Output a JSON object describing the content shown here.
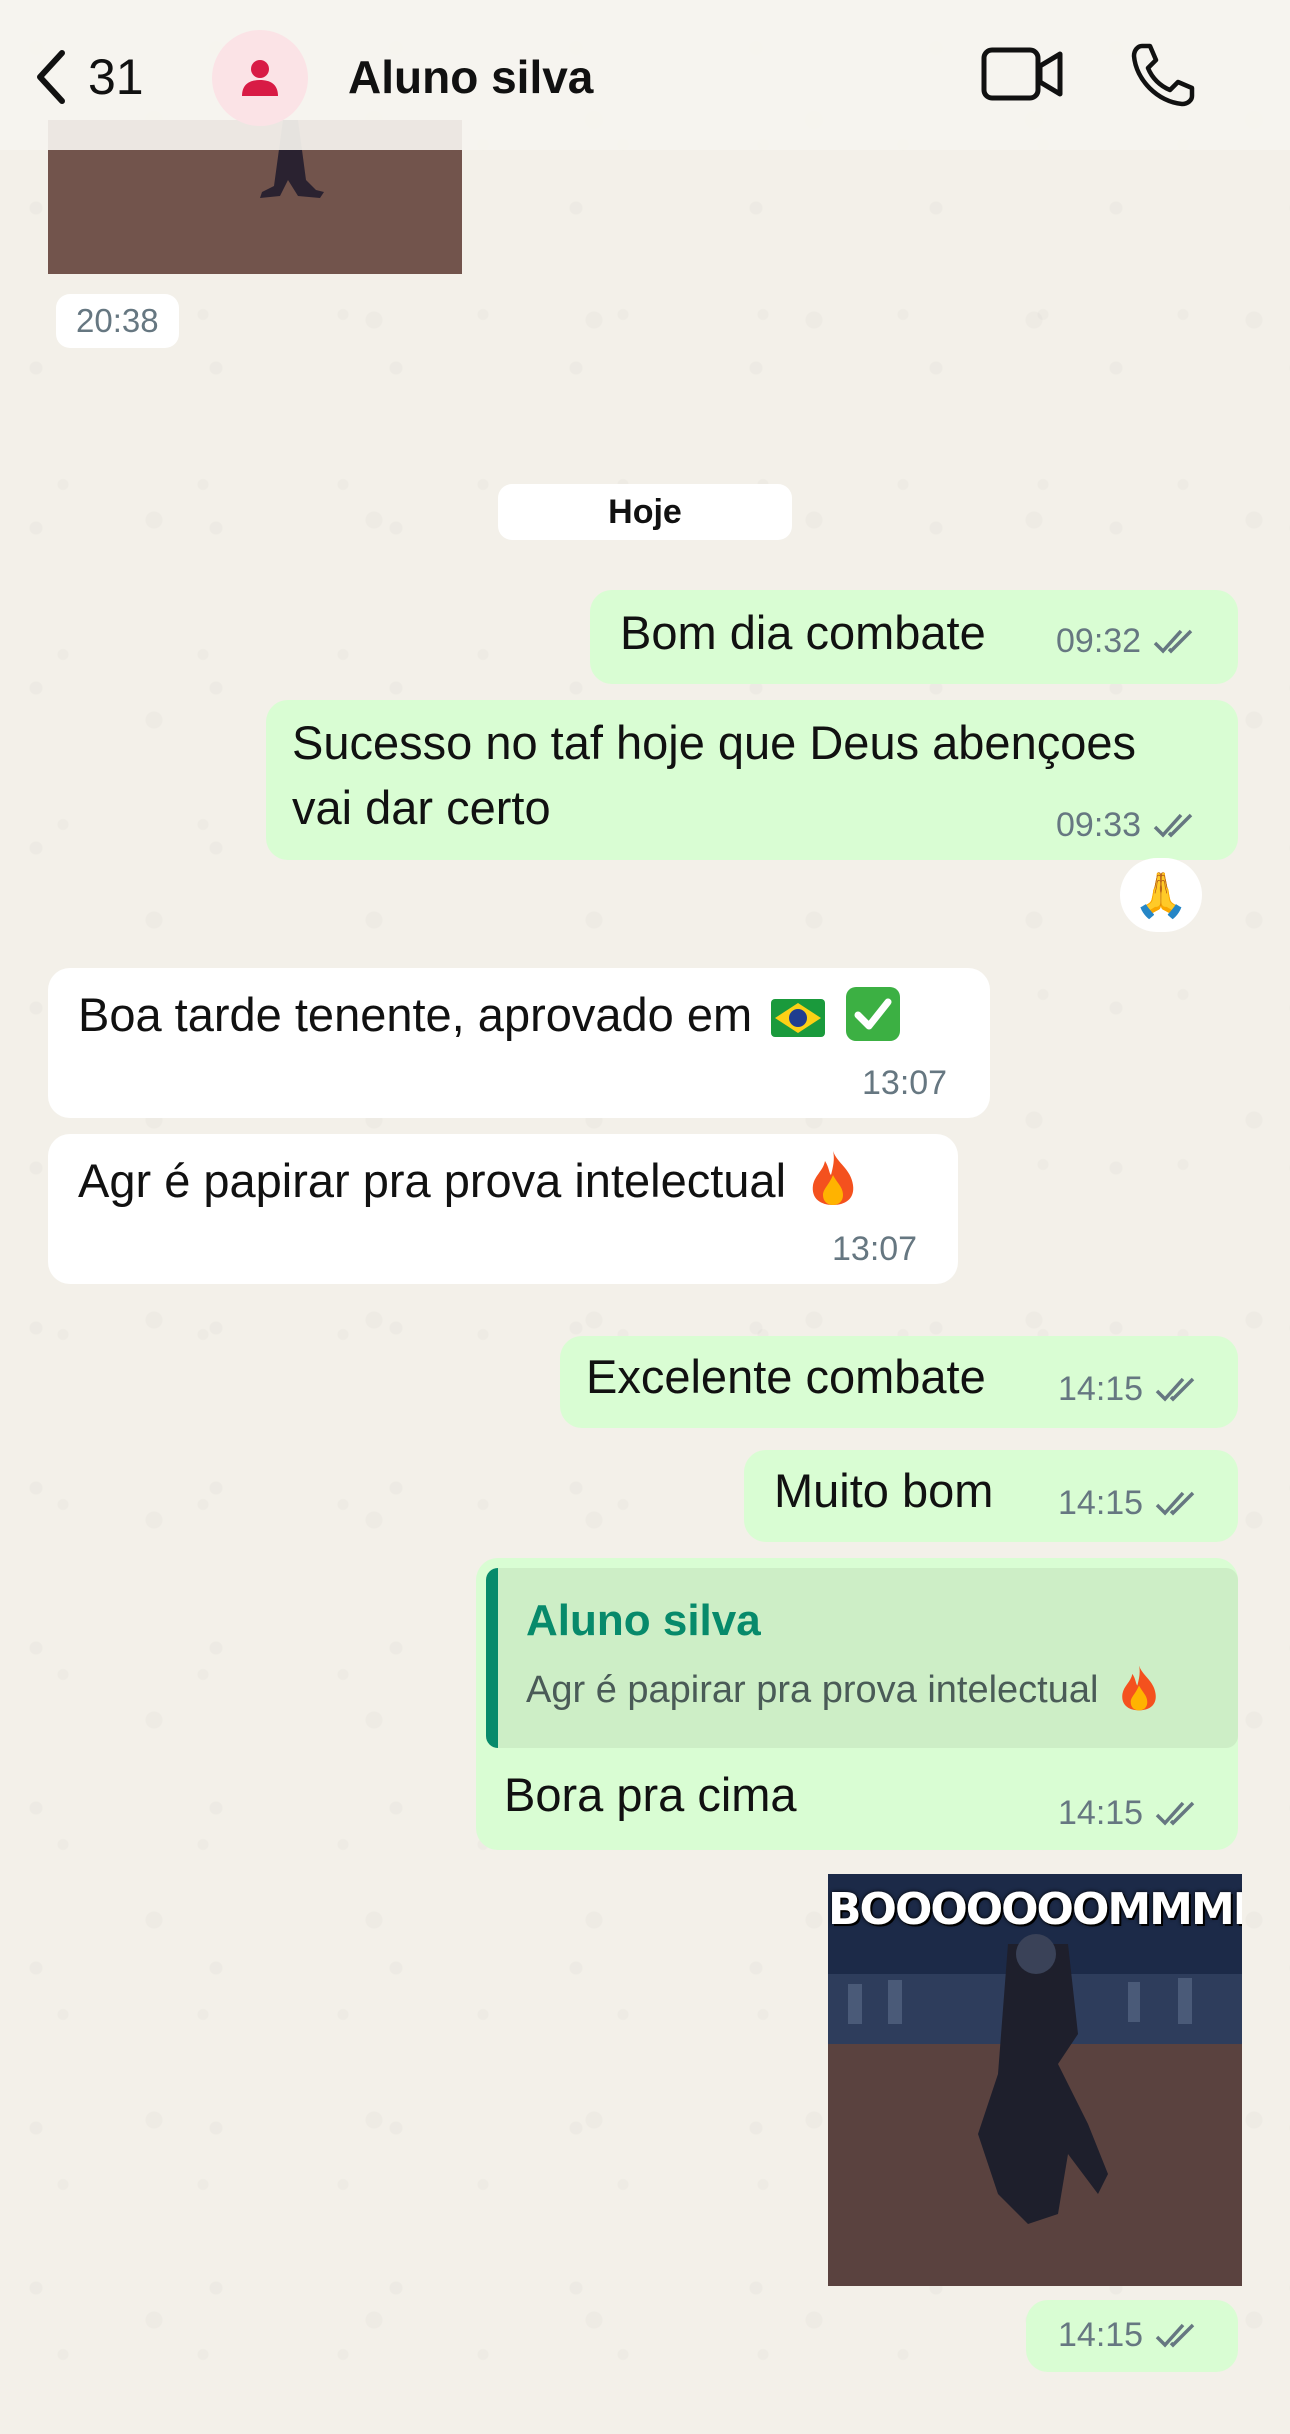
{
  "header": {
    "back_count": "31",
    "contact_name": "Aluno silva",
    "icons": [
      "chevron-left-icon",
      "person-icon",
      "video-call-icon",
      "phone-icon"
    ]
  },
  "chat": {
    "previous_timestamp": "20:38",
    "date_separator": "Hoje",
    "messages": [
      {
        "dir": "out",
        "text": "Bom dia combate",
        "time": "09:32"
      },
      {
        "dir": "out",
        "text_line1": "Sucesso no taf hoje que Deus abençoes",
        "text_line2": "vai dar certo",
        "time": "09:33",
        "reaction": "🙏"
      },
      {
        "dir": "in",
        "text": "Boa tarde tenente, aprovado em",
        "emojis": [
          "brazil-flag",
          "check-mark"
        ],
        "time": "13:07"
      },
      {
        "dir": "in",
        "text": "Agr é papirar pra prova intelectual",
        "emojis": [
          "fire"
        ],
        "time": "13:07"
      },
      {
        "dir": "out",
        "text": "Excelente combate",
        "time": "14:15"
      },
      {
        "dir": "out",
        "text": "Muito bom",
        "time": "14:15"
      },
      {
        "dir": "out",
        "quote_name": "Aluno silva",
        "quote_text": "Agr é papirar pra prova intelectual",
        "text": "Bora pra cima",
        "time": "14:15"
      },
      {
        "dir": "out",
        "gif_caption": "BOOOOOOOMMMM",
        "time": "14:15"
      }
    ]
  },
  "colors": {
    "outgoing_bubble": "#d9fdd3",
    "incoming_bubble": "#ffffff",
    "accent_green": "#078a6b",
    "avatar_bg": "#fbe3e6",
    "avatar_icon": "#d81b45",
    "read_ticks": "#667781"
  }
}
